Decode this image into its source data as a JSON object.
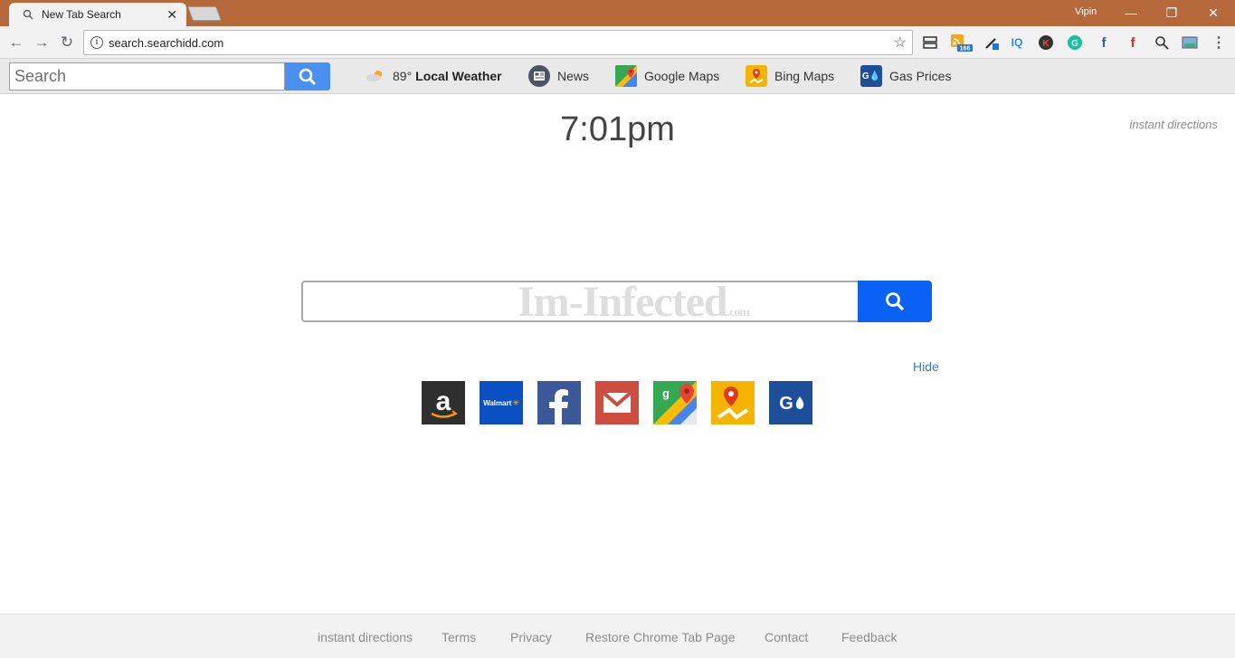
{
  "browser": {
    "tab_title": "New Tab Search",
    "user_name": "Vipin",
    "url": "search.searchidd.com",
    "rss_badge": "166"
  },
  "extension_bar": {
    "search_placeholder": "Search",
    "weather_temp": "89°",
    "weather_label": "Local Weather",
    "links": [
      "News",
      "Google Maps",
      "Bing Maps",
      "Gas Prices"
    ]
  },
  "page": {
    "time": "7:01pm",
    "instant_directions": "instant directions",
    "watermark": "Im-Infected",
    "watermark_suffix": ".com",
    "hide_label": "Hide",
    "walmart_label": "Walmart"
  },
  "footer": {
    "links": [
      "instant directions",
      "Terms",
      "Privacy",
      "Restore Chrome Tab Page",
      "Contact",
      "Feedback"
    ]
  },
  "colors": {
    "tabstrip": "#b5683a",
    "search_button": "#0a62f5",
    "ext_search_button": "#4a90f0",
    "hide_link": "#3a7bbf"
  },
  "tiles": [
    "amazon-icon",
    "walmart-icon",
    "facebook-icon",
    "gmail-icon",
    "google-maps-icon",
    "bing-maps-icon",
    "gas-prices-icon"
  ]
}
